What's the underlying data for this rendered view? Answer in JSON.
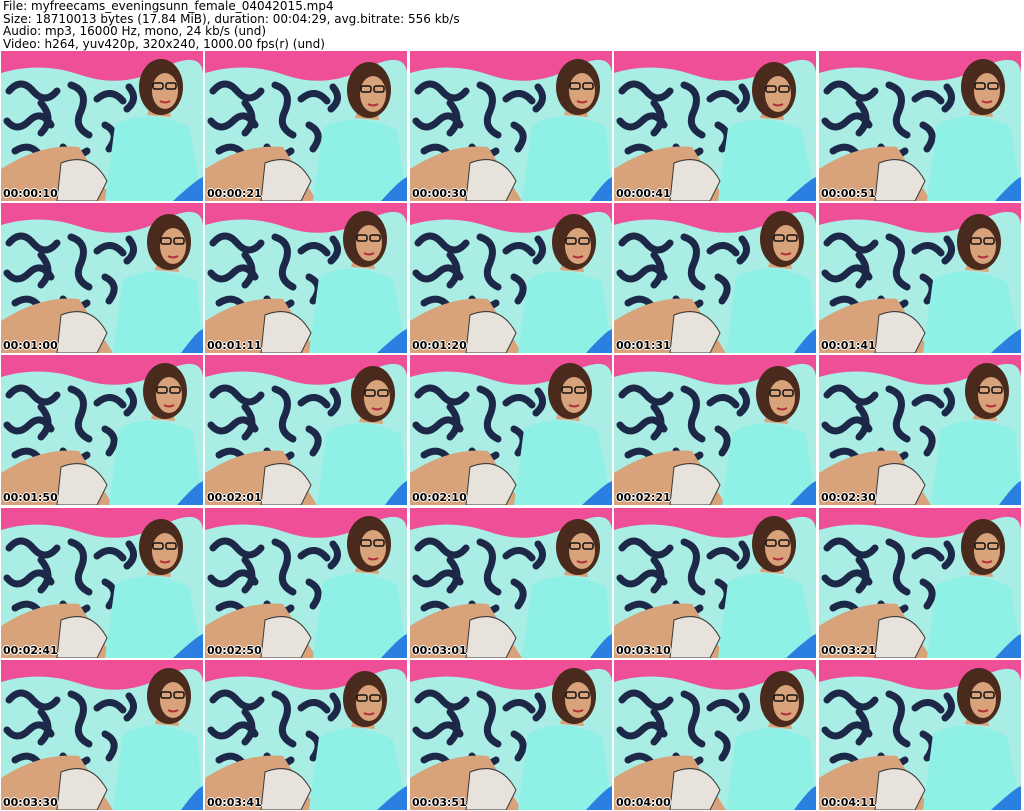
{
  "header": {
    "file_line": "File: myfreecams_eveningsunn_female_04042015.mp4",
    "size_line": "Size: 18710013 bytes (17.84 MiB), duration: 00:04:29, avg.bitrate: 556 kb/s",
    "audio_line": "Audio: mp3, 16000 Hz, mono, 24 kb/s (und)",
    "video_line": "Video: h264, yuv420p, 320x240, 1000.00 fps(r) (und)"
  },
  "colors": {
    "wall": "#ee4f96",
    "fabric_light": "#a9ede4",
    "fabric_dark": "#1d2747",
    "shirt": "#8ff0e6",
    "skin": "#d8a27a",
    "hair": "#4a2a1c",
    "pillow_blue": "#2a7fe0"
  },
  "thumbnails": [
    {
      "time": "00:00:10"
    },
    {
      "time": "00:00:21"
    },
    {
      "time": "00:00:30"
    },
    {
      "time": "00:00:41"
    },
    {
      "time": "00:00:51"
    },
    {
      "time": "00:01:00"
    },
    {
      "time": "00:01:11"
    },
    {
      "time": "00:01:20"
    },
    {
      "time": "00:01:31"
    },
    {
      "time": "00:01:41"
    },
    {
      "time": "00:01:50"
    },
    {
      "time": "00:02:01"
    },
    {
      "time": "00:02:10"
    },
    {
      "time": "00:02:21"
    },
    {
      "time": "00:02:30"
    },
    {
      "time": "00:02:41"
    },
    {
      "time": "00:02:50"
    },
    {
      "time": "00:03:01"
    },
    {
      "time": "00:03:10"
    },
    {
      "time": "00:03:21"
    },
    {
      "time": "00:03:30"
    },
    {
      "time": "00:03:41"
    },
    {
      "time": "00:03:51"
    },
    {
      "time": "00:04:00"
    },
    {
      "time": "00:04:11"
    }
  ]
}
